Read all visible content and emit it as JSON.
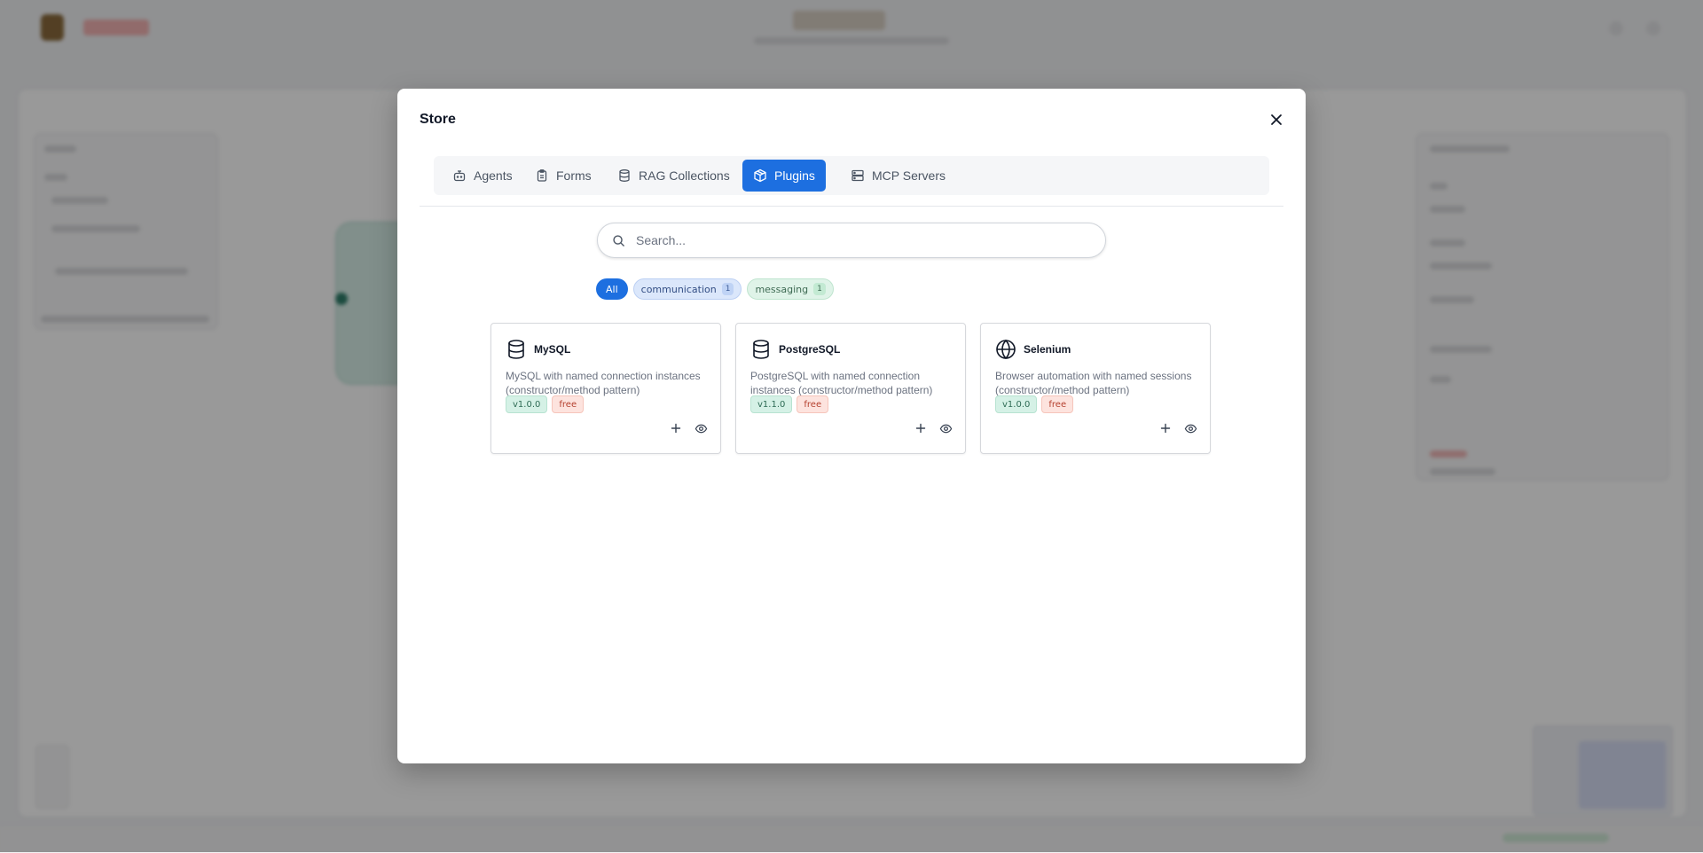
{
  "modal": {
    "title": "Store",
    "tabs": [
      {
        "label": "Agents",
        "icon": "bot-icon",
        "active": false
      },
      {
        "label": "Forms",
        "icon": "clipboard-icon",
        "active": false
      },
      {
        "label": "RAG Collections",
        "icon": "database-icon",
        "active": false
      },
      {
        "label": "Plugins",
        "icon": "package-icon",
        "active": true
      },
      {
        "label": "MCP Servers",
        "icon": "server-icon",
        "active": false
      }
    ],
    "search": {
      "placeholder": "Search..."
    },
    "filters": [
      {
        "label": "All",
        "count": null,
        "selected": true
      },
      {
        "label": "communication",
        "count": "1",
        "selected": false
      },
      {
        "label": "messaging",
        "count": "1",
        "selected": false
      }
    ],
    "plugins": [
      {
        "name": "MySQL",
        "icon": "database-icon",
        "description": "MySQL with named connection instances (constructor/method pattern)",
        "version": "v1.0.0",
        "price": "free"
      },
      {
        "name": "PostgreSQL",
        "icon": "database-icon",
        "description": "PostgreSQL with named connection instances (constructor/method pattern)",
        "version": "v1.1.0",
        "price": "free"
      },
      {
        "name": "Selenium",
        "icon": "globe-icon",
        "description": "Browser automation with named sessions (constructor/method pattern)",
        "version": "v1.0.0",
        "price": "free"
      }
    ]
  },
  "colors": {
    "accent": "#1d6fe0",
    "version_badge_bg": "#d5f1e6",
    "free_badge_bg": "#fde3de",
    "overlay": "rgba(0,0,0,0.40)"
  }
}
